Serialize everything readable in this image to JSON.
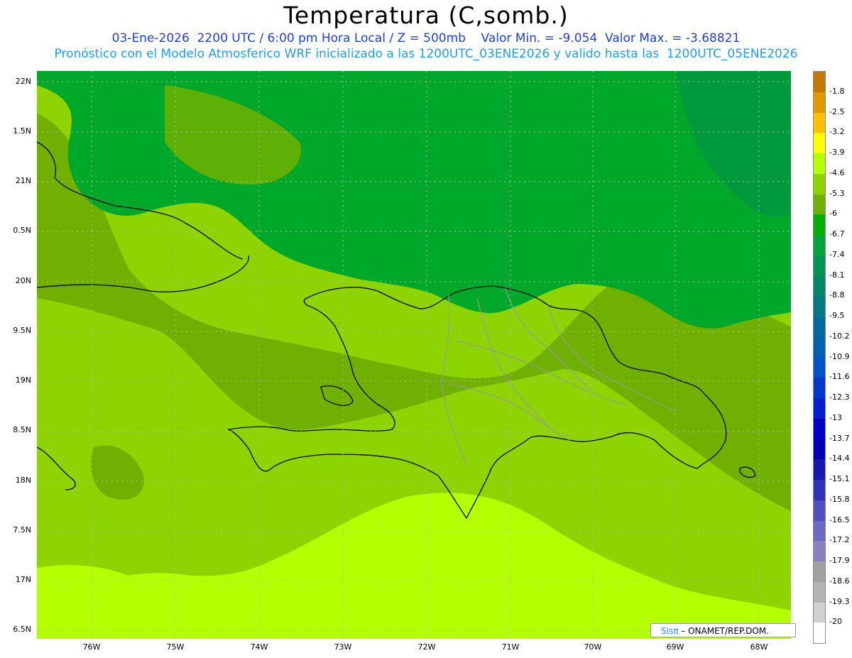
{
  "title": "Temperatura (C,somb.)",
  "subtitle1": "03-Ene-2026  2200 UTC / 6:00 pm Hora Local / Z = 500mb    Valor Min. = -9.054  Valor Max. = -3.68821",
  "subtitle2": "Pronóstico con el Modelo Atmosferico WRF inicializado a las 1200UTC_03ENE2026 y valido hasta las  1200UTC_05ENE2026",
  "lat_labels": [
    "22N",
    "1.5N",
    "21N",
    "0.5N",
    "20N",
    "9.5N",
    "19N",
    "8.5N",
    "18N",
    "7.5N",
    "17N",
    "6.5N"
  ],
  "lon_labels": [
    "76W",
    "75W",
    "74W",
    "73W",
    "72W",
    "71W",
    "70W",
    "69W",
    "68W"
  ],
  "colorbar": {
    "labels": [
      "-1.8",
      "-2.5",
      "-3.2",
      "-3.9",
      "-4.6",
      "-5.3",
      "-6",
      "-6.7",
      "-7.4",
      "-8.1",
      "-8.8",
      "-9.5",
      "-10.2",
      "-10.9",
      "-11.6",
      "-12.3",
      "-13",
      "-13.7",
      "-14.4",
      "-15.1",
      "-15.8",
      "-16.5",
      "-17.2",
      "-17.9",
      "-18.6",
      "-19.3",
      "-20"
    ],
    "colors": [
      "#c47a00",
      "#e09a00",
      "#ffc000",
      "#ffff00",
      "#b4ff00",
      "#8ed400",
      "#6fb000",
      "#00b000",
      "#00a33c",
      "#009550",
      "#008a6a",
      "#007a82",
      "#006b99",
      "#005fb0",
      "#0050c8",
      "#0038d0",
      "#0020d0",
      "#0000c8",
      "#0000b4",
      "#1818b0",
      "#3030b8",
      "#5050c0",
      "#6a6ac0",
      "#8a80c0",
      "#a0a0a0",
      "#b4b4b4",
      "#d0d0d0",
      "#ffffff"
    ]
  },
  "field_colors": {
    "yellow_green": "#b4ff00",
    "light_green": "#8ed400",
    "olive_green": "#6fb000",
    "green": "#00a82a",
    "dark_green": "#009a3c"
  },
  "credit": {
    "logo": "Sisπ",
    "text": "– ONAMET/REP.DOM."
  }
}
